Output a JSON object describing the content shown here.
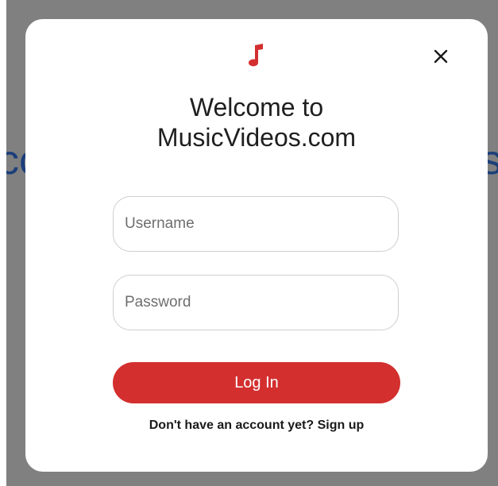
{
  "background": {
    "left_fragment": "cc",
    "right_fragment": "s"
  },
  "modal": {
    "title_line1": "Welcome to",
    "title_line2": "MusicVideos.com",
    "username_placeholder": "Username",
    "password_placeholder": "Password",
    "login_label": "Log In",
    "signup_prompt": "Don't have an account yet?",
    "signup_link": "Sign up",
    "icons": {
      "logo": "music-note-icon",
      "close": "close-icon"
    }
  },
  "colors": {
    "accent": "#d32f2f",
    "backdrop": "#808080",
    "background_text": "#1c3f7a"
  }
}
